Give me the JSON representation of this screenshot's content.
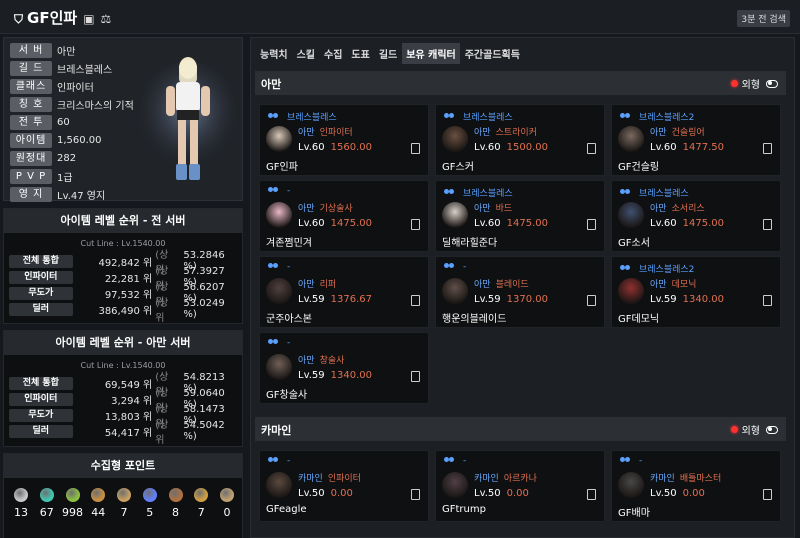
{
  "header": {
    "title": "GF인파",
    "updated": "3분 전 검색"
  },
  "profile": {
    "rows": [
      {
        "label": "서 버",
        "value": "아만"
      },
      {
        "label": "길 드",
        "value": "브레스블레스"
      },
      {
        "label": "클래스",
        "value": "인파이터"
      },
      {
        "label": "칭 호",
        "value": "크리스마스의 기적"
      },
      {
        "label": "전 투",
        "value": "60"
      },
      {
        "label": "아이템",
        "value": "1,560.00"
      },
      {
        "label": "원정대",
        "value": "282"
      },
      {
        "label": "P V P",
        "value": "1급"
      },
      {
        "label": "영 지",
        "value": "Lv.47 영지"
      }
    ]
  },
  "rank_all": {
    "title": "아이템 레벨 순위 - 전 서버",
    "cutline": "Cut Line : Lv.1540.00",
    "rows": [
      {
        "label": "전체 통합",
        "rank": "492,842 위",
        "sub": "(상위",
        "pct": "53.2846 %)"
      },
      {
        "label": "인파이터",
        "rank": "22,281 위",
        "sub": "(상위",
        "pct": "57.3927 %)"
      },
      {
        "label": "무도가",
        "rank": "97,532 위",
        "sub": "(상위",
        "pct": "56.6207 %)"
      },
      {
        "label": "딜러",
        "rank": "386,490 위",
        "sub": "(상위",
        "pct": "53.0249 %)"
      }
    ]
  },
  "rank_server": {
    "title": "아이템 레벨 순위 - 아만 서버",
    "cutline": "Cut Line : Lv.1540.00",
    "rows": [
      {
        "label": "전체 통합",
        "rank": "69,549 위",
        "sub": "(상위",
        "pct": "54.8213 %)"
      },
      {
        "label": "인파이터",
        "rank": "3,294 위",
        "sub": "(상위",
        "pct": "59.0640 %)"
      },
      {
        "label": "무도가",
        "rank": "13,803 위",
        "sub": "(상위",
        "pct": "58.1473 %)"
      },
      {
        "label": "딜러",
        "rank": "54,417 위",
        "sub": "(상위",
        "pct": "54.5042 %)"
      }
    ]
  },
  "collect": {
    "title": "수집형 포인트",
    "items": [
      {
        "icon": "mokoko-icon",
        "count": "13",
        "color": "#c8c8c8"
      },
      {
        "icon": "island-heart-icon",
        "count": "67",
        "color": "#40c8b0"
      },
      {
        "icon": "world-tree-leaf-icon",
        "count": "998",
        "color": "#8cc040"
      },
      {
        "icon": "adventure-book-icon",
        "count": "44",
        "color": "#c89040"
      },
      {
        "icon": "great-artwork-icon",
        "count": "7",
        "color": "#c8a060"
      },
      {
        "icon": "ignea-token-icon",
        "count": "5",
        "color": "#6080ff"
      },
      {
        "icon": "sea-bounty-icon",
        "count": "8",
        "color": "#b07040"
      },
      {
        "icon": "giants-heart-icon",
        "count": "7",
        "color": "#d0a040"
      },
      {
        "icon": "orpheus-star-icon",
        "count": "0",
        "color": "#c0a070"
      }
    ]
  },
  "tabs": [
    "능력치",
    "스킬",
    "수집",
    "도표",
    "길드",
    "보유 캐릭터",
    "주간골드획득"
  ],
  "active_tab": "보유 캐릭터",
  "servers": [
    {
      "name": "아만",
      "out_label": "외형",
      "characters": [
        {
          "guild": "브레스블레스",
          "server": "아만",
          "class": "인파이터",
          "level": "Lv.60",
          "item_level": "1560.00",
          "name": "GF인파",
          "portrait": "#d8c8b8"
        },
        {
          "guild": "브레스블레스",
          "server": "아만",
          "class": "스트라이커",
          "level": "Lv.60",
          "item_level": "1500.00",
          "name": "GF스커",
          "portrait": "#6a5040"
        },
        {
          "guild": "브레스블레스2",
          "server": "아만",
          "class": "건슬링어",
          "level": "Lv.60",
          "item_level": "1477.50",
          "name": "GF건슬링",
          "portrait": "#7a6a60"
        },
        {
          "guild": "-",
          "server": "아만",
          "class": "기상술사",
          "level": "Lv.60",
          "item_level": "1475.00",
          "name": "겨존쩜민겨",
          "portrait": "#e8b8c8"
        },
        {
          "guild": "브레스블레스",
          "server": "아만",
          "class": "바드",
          "level": "Lv.60",
          "item_level": "1475.00",
          "name": "딜해라힐준다",
          "portrait": "#d8d0c8"
        },
        {
          "guild": "브레스블레스",
          "server": "아만",
          "class": "소서리스",
          "level": "Lv.60",
          "item_level": "1475.00",
          "name": "GF소서",
          "portrait": "#405070"
        },
        {
          "guild": "-",
          "server": "아만",
          "class": "리퍼",
          "level": "Lv.59",
          "item_level": "1376.67",
          "name": "군주아스본",
          "portrait": "#504040"
        },
        {
          "guild": "-",
          "server": "아만",
          "class": "블레이드",
          "level": "Lv.59",
          "item_level": "1370.00",
          "name": "행운의블레이드",
          "portrait": "#605048"
        },
        {
          "guild": "브레스블레스2",
          "server": "아만",
          "class": "데모닉",
          "level": "Lv.59",
          "item_level": "1340.00",
          "name": "GF데모닉",
          "portrait": "#903030"
        },
        {
          "guild": "-",
          "server": "아만",
          "class": "창술사",
          "level": "Lv.59",
          "item_level": "1340.00",
          "name": "GF창술사",
          "portrait": "#706058"
        }
      ]
    },
    {
      "name": "카마인",
      "out_label": "외형",
      "characters": [
        {
          "guild": "-",
          "server": "카마인",
          "class": "인파이터",
          "level": "Lv.50",
          "item_level": "0.00",
          "name": "GFeagle",
          "portrait": "#5a4a40"
        },
        {
          "guild": "-",
          "server": "카마인",
          "class": "아르카나",
          "level": "Lv.50",
          "item_level": "0.00",
          "name": "GFtrump",
          "portrait": "#504048"
        },
        {
          "guild": "-",
          "server": "카마인",
          "class": "배틀마스터",
          "level": "Lv.50",
          "item_level": "0.00",
          "name": "GF배마",
          "portrait": "#484848"
        }
      ]
    }
  ]
}
